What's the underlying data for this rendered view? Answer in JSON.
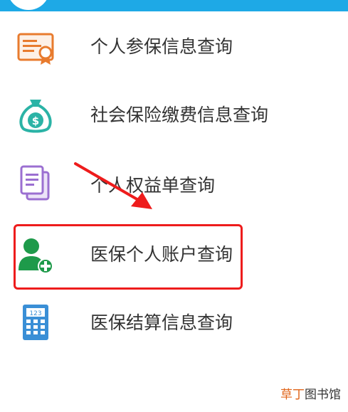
{
  "menu": {
    "items": [
      {
        "label": "个人参保信息查询",
        "icon": "certificate-icon"
      },
      {
        "label": "社会保险缴费信息查询",
        "icon": "money-bag-icon"
      },
      {
        "label": "个人权益单查询",
        "icon": "documents-icon"
      },
      {
        "label": "医保个人账户查询",
        "icon": "add-user-icon"
      },
      {
        "label": "医保结算信息查询",
        "icon": "calculator-icon"
      }
    ],
    "highlighted_index": 3
  },
  "watermark": {
    "accent": "草丁",
    "rest": "图书馆"
  },
  "colors": {
    "topbar": "#1ea9e6",
    "highlight": "#ee1c1c",
    "arrow": "#ee1c1c",
    "icon_orange": "#e87b2e",
    "icon_teal": "#2bb3a6",
    "icon_purple": "#9b6fd1",
    "icon_green": "#1e9a4a",
    "icon_blue": "#3a8fd6"
  }
}
